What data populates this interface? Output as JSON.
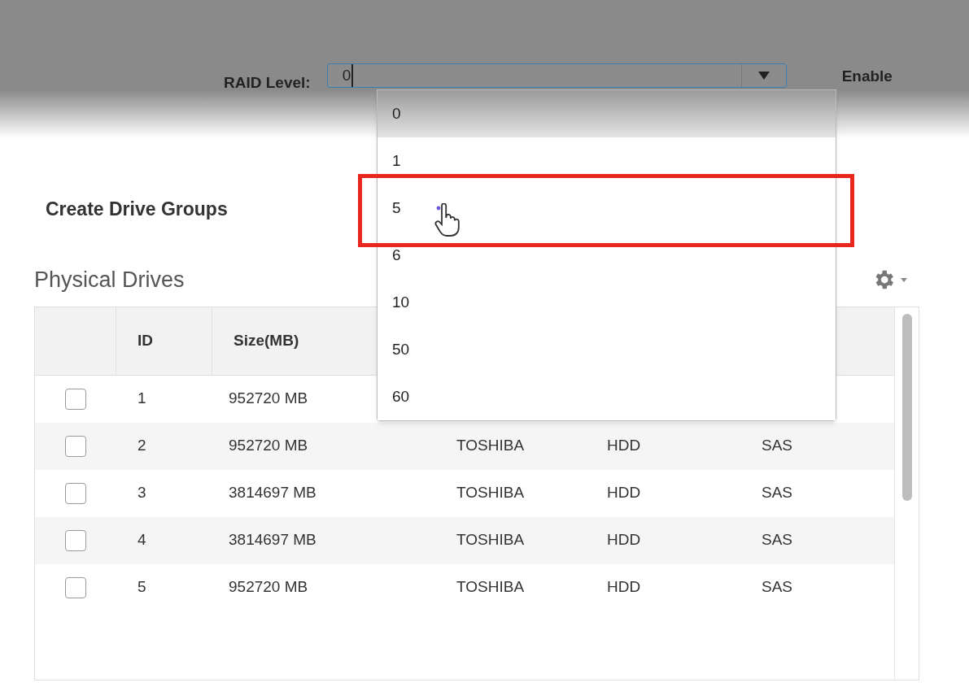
{
  "raid_level": {
    "label": "RAID Level:",
    "value": "0",
    "options": [
      {
        "label": "0",
        "selected": true,
        "highlighted": false
      },
      {
        "label": "1",
        "selected": false,
        "highlighted": false
      },
      {
        "label": "5",
        "selected": false,
        "highlighted": true
      },
      {
        "label": "6",
        "selected": false,
        "highlighted": false
      },
      {
        "label": "10",
        "selected": false,
        "highlighted": false
      },
      {
        "label": "50",
        "selected": false,
        "highlighted": false
      },
      {
        "label": "60",
        "selected": false,
        "highlighted": false
      }
    ]
  },
  "enable_label": "Enable",
  "section_title": "Create Drive Groups",
  "physical_drives": {
    "title": "Physical Drives",
    "columns": [
      "ID",
      "Size(MB)"
    ],
    "rows": [
      {
        "checked": false,
        "cells": [
          "1",
          "952720 MB"
        ]
      },
      {
        "checked": false,
        "cells": [
          "2",
          "952720 MB",
          "TOSHIBA",
          "HDD",
          "SAS"
        ]
      },
      {
        "checked": false,
        "cells": [
          "3",
          "3814697 MB",
          "TOSHIBA",
          "HDD",
          "SAS"
        ]
      },
      {
        "checked": false,
        "cells": [
          "4",
          "3814697 MB",
          "TOSHIBA",
          "HDD",
          "SAS"
        ]
      },
      {
        "checked": false,
        "cells": [
          "5",
          "952720 MB",
          "TOSHIBA",
          "HDD",
          "SAS"
        ]
      }
    ]
  }
}
